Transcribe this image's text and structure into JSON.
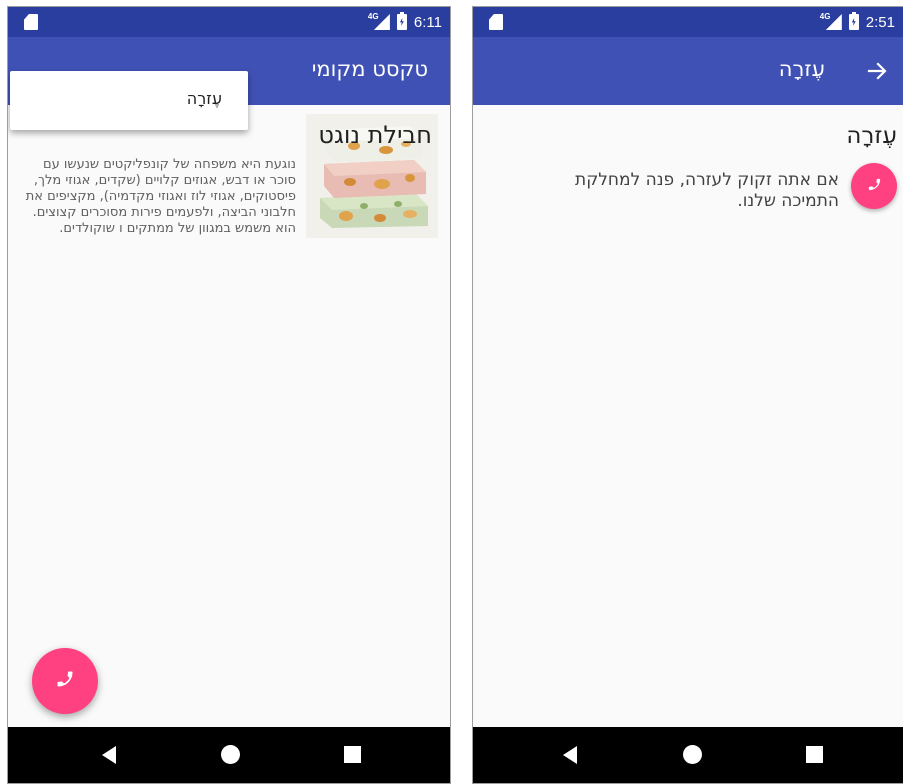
{
  "left_screen": {
    "status_bar": {
      "network": "4G",
      "time": "6:11"
    },
    "app_bar": {
      "title": "טקסט מקומי"
    },
    "popup_menu": {
      "items": [
        {
          "label": "עֶזרָה"
        }
      ]
    },
    "card": {
      "title": "חבילת נוגט",
      "description": "נוגעת היא משפחה של קונפליקטים שנעשו עם סוכר או דבש, אגוזים קלויים (שקדים, אגוזי מלך, פיסטוקים, אגוזי לוז ואגוזי מקדמיה), מקציפים את חלבוני הביצה, ולפעמים פירות מסוכרים קצוצים. הוא משמש במגוון של ממתקים ו שוקולדים.",
      "image_icon": "nougat-image"
    },
    "fab": {
      "icon": "phone-icon"
    }
  },
  "right_screen": {
    "status_bar": {
      "network": "4G",
      "time": "2:51"
    },
    "app_bar": {
      "title": "עֶזרָה",
      "back_icon": "arrow-back-icon"
    },
    "content": {
      "heading": "עֶזרָה",
      "body": "אם אתה זקוק לעזרה, פנה למחלקת התמיכה שלנו.",
      "call_icon": "phone-icon"
    }
  },
  "nav_bar": {
    "icons": [
      "back-icon",
      "home-icon",
      "recents-icon"
    ]
  },
  "colors": {
    "primary": "#3f51b5",
    "primary_dark": "#2a3e9f",
    "accent": "#ff4081",
    "background": "#fafafa",
    "nav_bar": "#000000"
  }
}
